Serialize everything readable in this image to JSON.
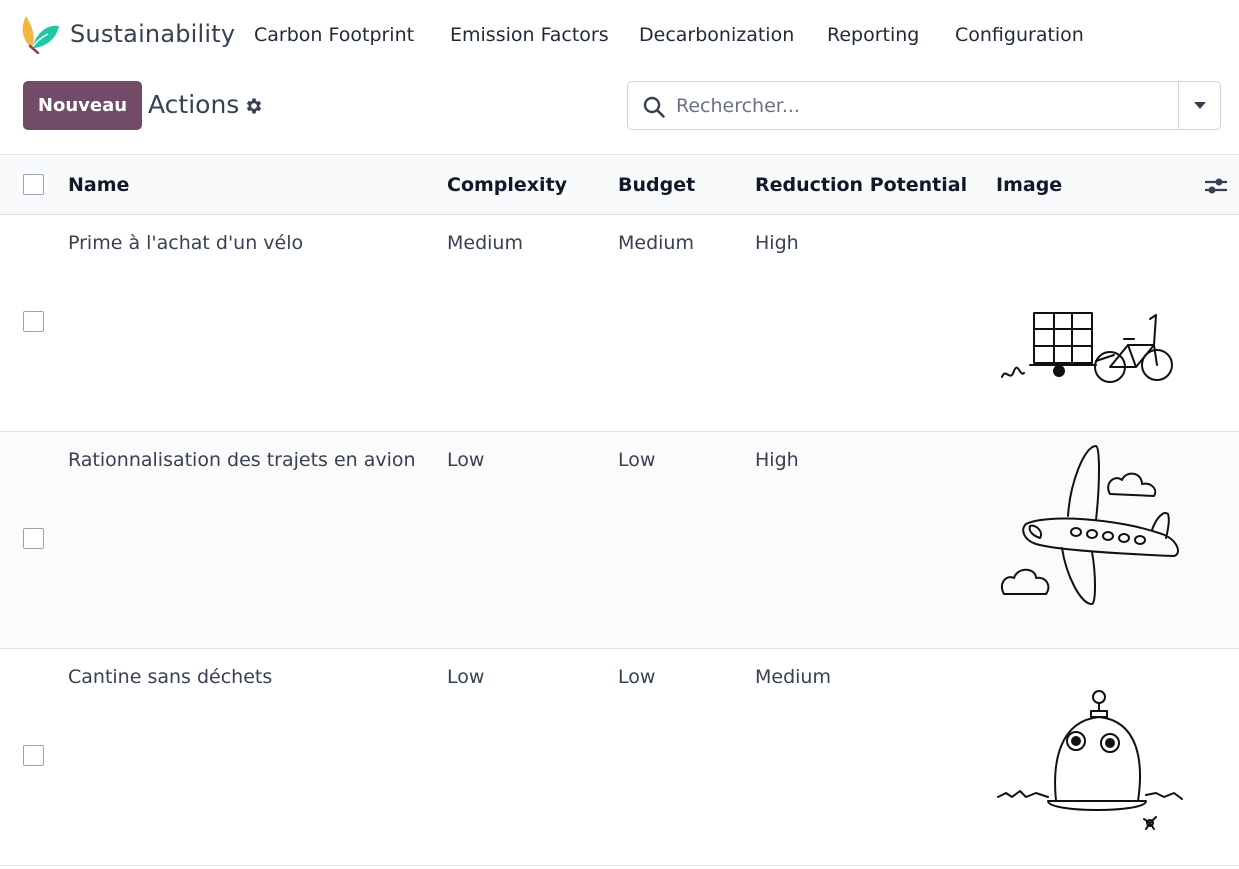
{
  "app": {
    "name": "Sustainability",
    "logo_icon": "leaf-logo-icon",
    "brand_color": "#714b67"
  },
  "menu": [
    {
      "label": "Carbon Footprint"
    },
    {
      "label": "Emission Factors"
    },
    {
      "label": "Decarbonization"
    },
    {
      "label": "Reporting"
    },
    {
      "label": "Configuration"
    }
  ],
  "control_panel": {
    "new_button_label": "Nouveau",
    "breadcrumb": "Actions",
    "gear_icon": "gear-icon"
  },
  "search": {
    "placeholder": "Rechercher...",
    "value": "",
    "icon": "search-icon",
    "toggle_icon": "caret-down-icon"
  },
  "table": {
    "columns": [
      "Name",
      "Complexity",
      "Budget",
      "Reduction Potential",
      "Image"
    ],
    "optional_columns_icon": "sliders-icon",
    "rows": [
      {
        "name": "Prime à l'achat d'un vélo",
        "complexity": "Medium",
        "budget": "Medium",
        "reduction_potential": "High",
        "image_icon": "bicycle-trailer-drawing"
      },
      {
        "name": "Rationnalisation des trajets en avion",
        "complexity": "Low",
        "budget": "Low",
        "reduction_potential": "High",
        "image_icon": "airplane-drawing"
      },
      {
        "name": "Cantine sans déchets",
        "complexity": "Low",
        "budget": "Low",
        "reduction_potential": "Medium",
        "image_icon": "composter-drawing"
      }
    ]
  }
}
